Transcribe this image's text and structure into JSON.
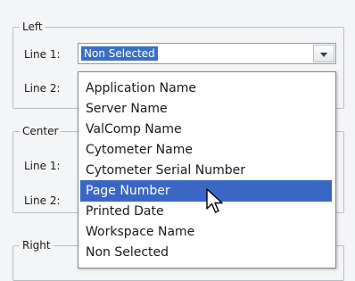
{
  "left_group": {
    "legend": "Left",
    "line1_label": "Line 1:",
    "line1_value": "Non Selected",
    "line2_label": "Line 2:"
  },
  "center_group": {
    "legend": "Center",
    "line1_label": "Line 1:",
    "line2_label": "Line 2:"
  },
  "right_group": {
    "legend": "Right"
  },
  "dropdown": {
    "options": [
      "Application Name",
      "Server Name",
      "ValComp Name",
      "Cytometer Name",
      "Cytometer Serial Number",
      "Page Number",
      "Printed Date",
      "Workspace Name",
      "Non Selected"
    ],
    "hovered_option": "Page Number"
  },
  "colors": {
    "selection": "#3a67c4",
    "background": "#f4f5f7"
  },
  "icons": [
    "chevron-down-icon",
    "mouse-pointer-icon"
  ]
}
